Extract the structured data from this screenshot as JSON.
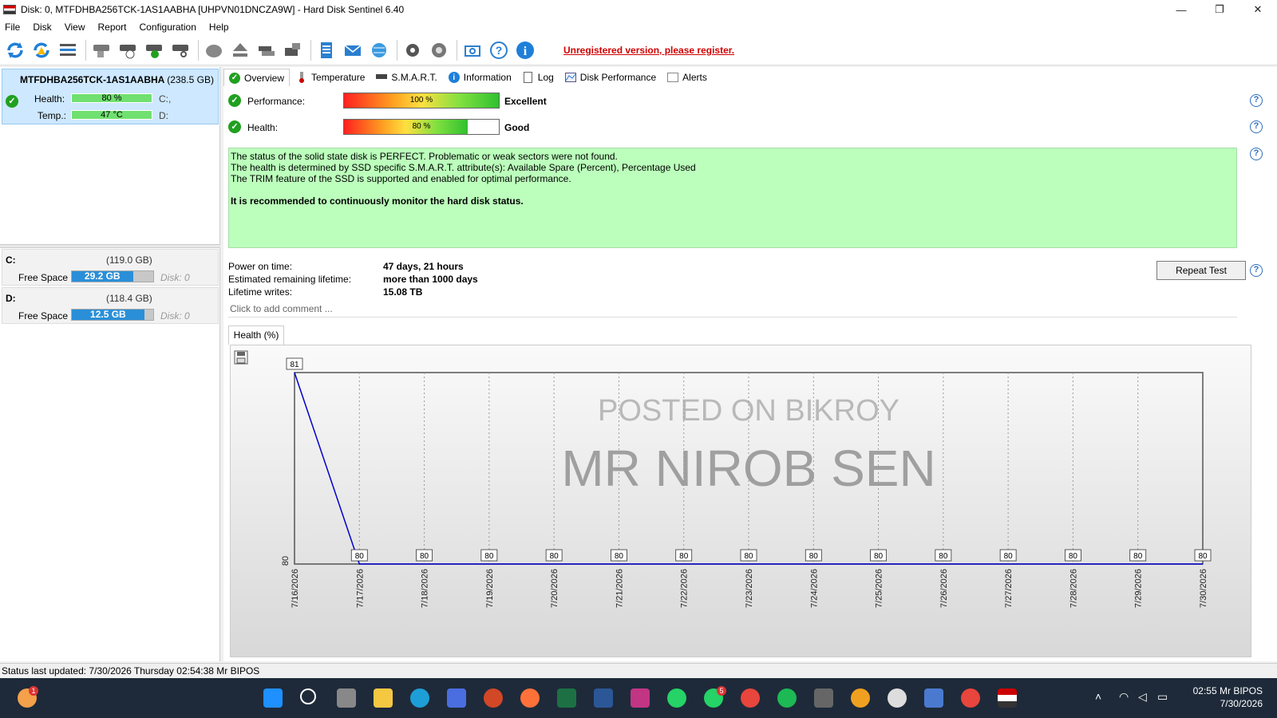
{
  "window": {
    "title": "Disk: 0, MTFDHBA256TCK-1AS1AABHA [UHPVN01DNCZA9W]  -  Hard Disk Sentinel 6.40",
    "minimize": "—",
    "maximize": "❐",
    "close": "✕"
  },
  "menu": [
    "File",
    "Disk",
    "View",
    "Report",
    "Configuration",
    "Help"
  ],
  "toolbar": {
    "register_text": "Unregistered version, please register."
  },
  "disk": {
    "name": "MTFDHBA256TCK-1AS1AABHA",
    "capacity": "(238.5 GB)",
    "health_label": "Health:",
    "health_value": "80 %",
    "health_drive": "C:,",
    "temp_label": "Temp.:",
    "temp_value": "47 °C",
    "temp_drive": "D:"
  },
  "volumes": [
    {
      "letter": "C:",
      "capacity": "(119.0 GB)",
      "free_label": "Free Space",
      "free_value": "29.2 GB",
      "disk": "Disk: 0",
      "used_fraction": 0.75
    },
    {
      "letter": "D:",
      "capacity": "(118.4 GB)",
      "free_label": "Free Space",
      "free_value": "12.5 GB",
      "disk": "Disk: 0",
      "used_fraction": 0.89
    }
  ],
  "tabs": [
    "Overview",
    "Temperature",
    "S.M.A.R.T.",
    "Information",
    "Log",
    "Disk Performance",
    "Alerts"
  ],
  "overview": {
    "performance_label": "Performance:",
    "performance_pct": "100 %",
    "performance_value": 1.0,
    "performance_verdict": "Excellent",
    "health_label": "Health:",
    "health_pct": "80 %",
    "health_value": 0.8,
    "health_verdict": "Good",
    "status_lines": [
      "The status of the solid state disk is PERFECT. Problematic or weak sectors were not found.",
      "The health is determined by SSD specific S.M.A.R.T. attribute(s):  Available Spare (Percent), Percentage Used",
      "The TRIM feature of the SSD is supported and enabled for optimal performance."
    ],
    "status_recommendation": "It is recommended to continuously monitor the hard disk status.",
    "power_on_label": "Power on time:",
    "power_on_value": "47 days, 21 hours",
    "remaining_label": "Estimated remaining lifetime:",
    "remaining_value": "more than 1000 days",
    "writes_label": "Lifetime writes:",
    "writes_value": "15.08 TB",
    "repeat_button": "Repeat Test",
    "comment_placeholder": "Click to add comment ..."
  },
  "chart_tab": "Health (%)",
  "watermark": {
    "line1": "POSTED ON BIKROY",
    "line2": "MR NIROB SEN"
  },
  "chart_data": {
    "type": "line",
    "x": [
      "7/16/2026",
      "7/17/2026",
      "7/18/2026",
      "7/19/2026",
      "7/20/2026",
      "7/21/2026",
      "7/22/2026",
      "7/23/2026",
      "7/24/2026",
      "7/25/2026",
      "7/26/2026",
      "7/27/2026",
      "7/28/2026",
      "7/29/2026",
      "7/30/2026"
    ],
    "series": [
      {
        "values": [
          81,
          80,
          80,
          80,
          80,
          80,
          80,
          80,
          80,
          80,
          80,
          80,
          80,
          80,
          80
        ]
      }
    ],
    "ylim": [
      80,
      81
    ],
    "ytick_labels": [
      "80"
    ],
    "color": "#0000cc",
    "grid": true
  },
  "statusbar": "Status last updated: 7/30/2026 Thursday 02:54:38 Mr BIPOS",
  "taskbar": {
    "time": "02:55 Mr BIPOS",
    "date": "7/30/2026",
    "weather_badge": "1",
    "whatsapp_badge": "5"
  }
}
